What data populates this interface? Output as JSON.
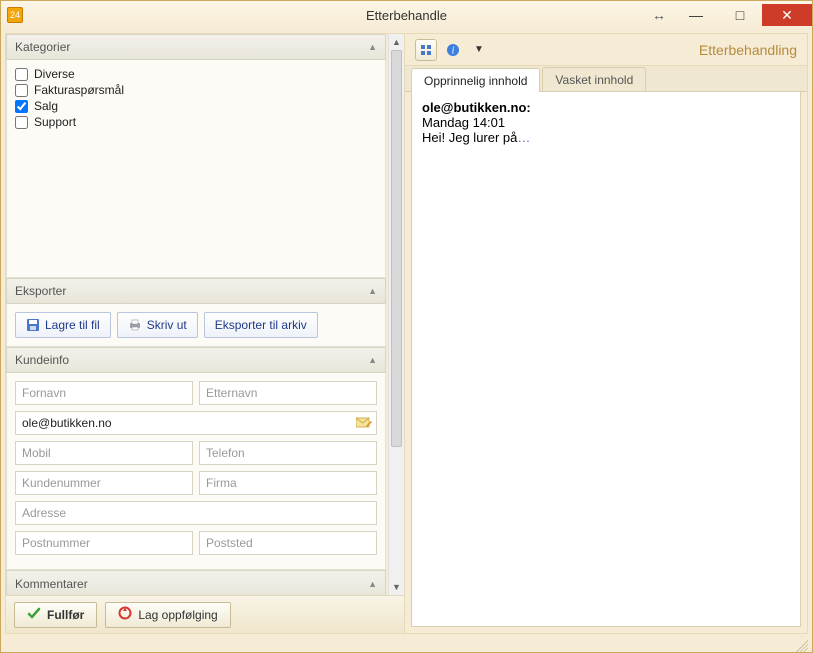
{
  "window": {
    "title": "Etterbehandle"
  },
  "left": {
    "categories": {
      "header": "Kategorier",
      "items": [
        {
          "label": "Diverse",
          "checked": false
        },
        {
          "label": "Fakturaspørsmål",
          "checked": false
        },
        {
          "label": "Salg",
          "checked": true
        },
        {
          "label": "Support",
          "checked": false
        }
      ]
    },
    "export": {
      "header": "Eksporter",
      "save_label": "Lagre til fil",
      "print_label": "Skriv ut",
      "archive_label": "Eksporter til arkiv"
    },
    "customer": {
      "header": "Kundeinfo",
      "fornavn_ph": "Fornavn",
      "etternavn_ph": "Etternavn",
      "email_value": "ole@butikken.no",
      "mobil_ph": "Mobil",
      "telefon_ph": "Telefon",
      "kundenr_ph": "Kundenummer",
      "firma_ph": "Firma",
      "adresse_ph": "Adresse",
      "postnr_ph": "Postnummer",
      "poststed_ph": "Poststed"
    },
    "comments": {
      "header": "Kommentarer"
    }
  },
  "footer": {
    "complete_label": "Fullfør",
    "followup_label": "Lag oppfølging"
  },
  "right": {
    "title": "Etterbehandling",
    "tabs": {
      "original": "Opprinnelig innhold",
      "washed": "Vasket innhold"
    },
    "message": {
      "from": "ole@butikken.no:",
      "when": "Mandag 14:01",
      "body": "Hei! Jeg lurer på",
      "ellipsis": "…"
    }
  }
}
